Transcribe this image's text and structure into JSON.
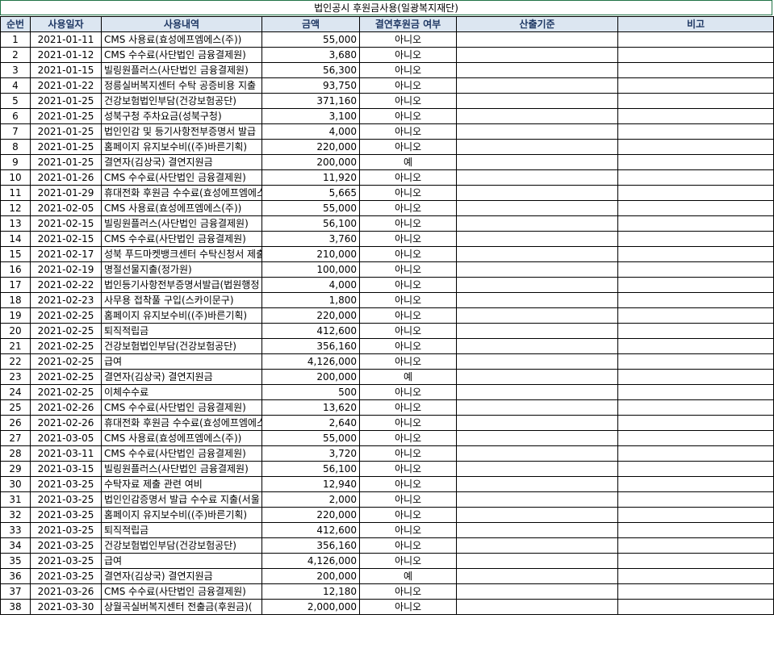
{
  "title": "법인공시 후원금사용(일광복지재단)",
  "headers": [
    "순번",
    "사용일자",
    "사용내역",
    "금액",
    "결연후원금 여부",
    "산출기준",
    "비고"
  ],
  "rows": [
    [
      "1",
      "2021-01-11",
      "CMS 사용료(효성에프엠에스(주))",
      "55,000",
      "아니오"
    ],
    [
      "2",
      "2021-01-12",
      "CMS 수수료(사단법인 금융결제원)",
      "3,680",
      "아니오"
    ],
    [
      "3",
      "2021-01-15",
      "빌링원플러스(사단법인 금융결제원)",
      "56,300",
      "아니오"
    ],
    [
      "4",
      "2021-01-22",
      "정릉실버복지센터 수탁 공증비용 지출",
      "93,750",
      "아니오"
    ],
    [
      "5",
      "2021-01-25",
      "건강보험법인부담(건강보험공단)",
      "371,160",
      "아니오"
    ],
    [
      "6",
      "2021-01-25",
      "성북구청 주차요금(성북구청)",
      "3,100",
      "아니오"
    ],
    [
      "7",
      "2021-01-25",
      "법인인감 및 등기사항전부증명서 발급",
      "4,000",
      "아니오"
    ],
    [
      "8",
      "2021-01-25",
      "홈페이지 유지보수비((주)바른기획)",
      "220,000",
      "아니오"
    ],
    [
      "9",
      "2021-01-25",
      "결연자(김상국) 결연지원금",
      "200,000",
      "예"
    ],
    [
      "10",
      "2021-01-26",
      "CMS 수수료(사단법인 금융결제원)",
      "11,920",
      "아니오"
    ],
    [
      "11",
      "2021-01-29",
      "휴대전화 후원금 수수료(효성에프엠에스",
      "5,665",
      "아니오"
    ],
    [
      "12",
      "2021-02-05",
      "CMS 사용료(효성에프엠에스(주))",
      "55,000",
      "아니오"
    ],
    [
      "13",
      "2021-02-15",
      "빌링원플러스(사단법인 금융결제원)",
      "56,100",
      "아니오"
    ],
    [
      "14",
      "2021-02-15",
      "CMS 수수료(사단법인 금융결제원)",
      "3,760",
      "아니오"
    ],
    [
      "15",
      "2021-02-17",
      "성북 푸드마켓뱅크센터 수탁신청서 제출",
      "210,000",
      "아니오"
    ],
    [
      "16",
      "2021-02-19",
      "명절선물지출(정가원)",
      "100,000",
      "아니오"
    ],
    [
      "17",
      "2021-02-22",
      "법인등기사항전부증명서발급(법원행정",
      "4,000",
      "아니오"
    ],
    [
      "18",
      "2021-02-23",
      "사무용 접착풀 구입(스카이문구)",
      "1,800",
      "아니오"
    ],
    [
      "19",
      "2021-02-25",
      "홈페이지 유지보수비((주)바른기획)",
      "220,000",
      "아니오"
    ],
    [
      "20",
      "2021-02-25",
      "퇴직적립금",
      "412,600",
      "아니오"
    ],
    [
      "21",
      "2021-02-25",
      "건강보험법인부담(건강보험공단)",
      "356,160",
      "아니오"
    ],
    [
      "22",
      "2021-02-25",
      "급여",
      "4,126,000",
      "아니오"
    ],
    [
      "23",
      "2021-02-25",
      "결연자(김상국) 결연지원금",
      "200,000",
      "예"
    ],
    [
      "24",
      "2021-02-25",
      "이체수수료",
      "500",
      "아니오"
    ],
    [
      "25",
      "2021-02-26",
      "CMS 수수료(사단법인 금융결제원)",
      "13,620",
      "아니오"
    ],
    [
      "26",
      "2021-02-26",
      "휴대전화 후원금 수수료(효성에프엠에스",
      "2,640",
      "아니오"
    ],
    [
      "27",
      "2021-03-05",
      "CMS 사용료(효성에프엠에스(주))",
      "55,000",
      "아니오"
    ],
    [
      "28",
      "2021-03-11",
      "CMS 수수료(사단법인 금융결제원)",
      "3,720",
      "아니오"
    ],
    [
      "29",
      "2021-03-15",
      "빌링원플러스(사단법인 금융결제원)",
      "56,100",
      "아니오"
    ],
    [
      "30",
      "2021-03-25",
      "수탁자료 제출 관련 여비",
      "12,940",
      "아니오"
    ],
    [
      "31",
      "2021-03-25",
      "법인인감증명서 발급 수수료 지출(서울",
      "2,000",
      "아니오"
    ],
    [
      "32",
      "2021-03-25",
      "홈페이지 유지보수비((주)바른기획)",
      "220,000",
      "아니오"
    ],
    [
      "33",
      "2021-03-25",
      "퇴직적립금",
      "412,600",
      "아니오"
    ],
    [
      "34",
      "2021-03-25",
      "건강보험법인부담(건강보험공단)",
      "356,160",
      "아니오"
    ],
    [
      "35",
      "2021-03-25",
      "급여",
      "4,126,000",
      "아니오"
    ],
    [
      "36",
      "2021-03-25",
      "결연자(김상국) 결연지원금",
      "200,000",
      "예"
    ],
    [
      "37",
      "2021-03-26",
      "CMS 수수료(사단법인 금융결제원)",
      "12,180",
      "아니오"
    ],
    [
      "38",
      "2021-03-30",
      "상월곡실버복지센터 전출금(후원금)(",
      "2,000,000",
      "아니오"
    ]
  ]
}
